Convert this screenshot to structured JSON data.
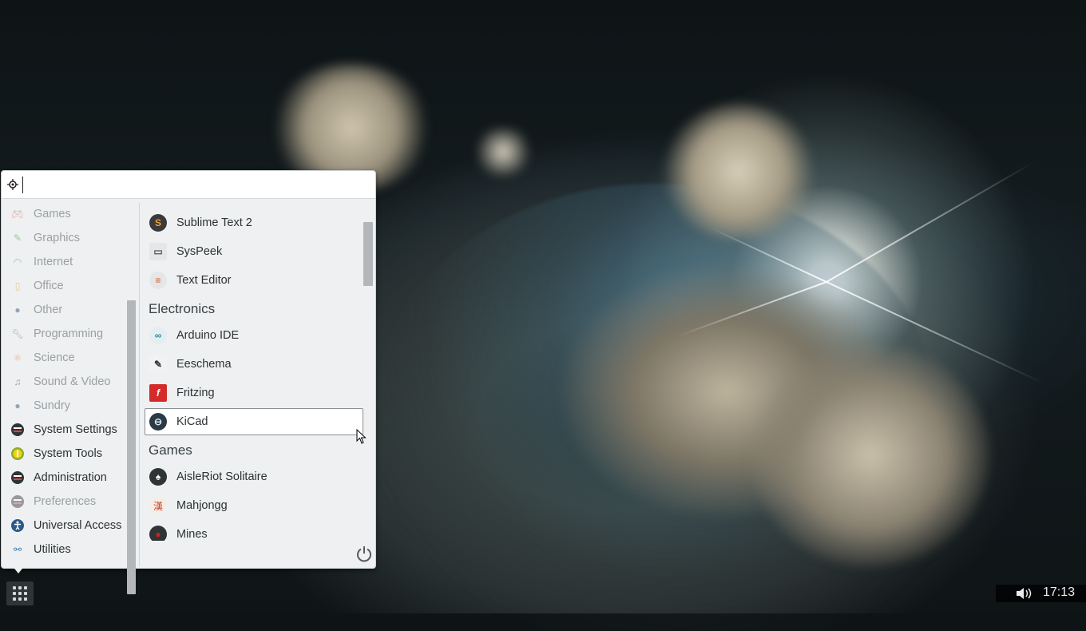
{
  "search": {
    "value": "",
    "placeholder": ""
  },
  "categories": [
    {
      "label": "Games",
      "icon": "gamepad-icon",
      "active": false
    },
    {
      "label": "Graphics",
      "icon": "brush-icon",
      "active": false
    },
    {
      "label": "Internet",
      "icon": "globe-icon",
      "active": false
    },
    {
      "label": "Office",
      "icon": "document-icon",
      "active": false
    },
    {
      "label": "Other",
      "icon": "other-icon",
      "active": false
    },
    {
      "label": "Programming",
      "icon": "wrench-icon",
      "active": false
    },
    {
      "label": "Science",
      "icon": "atom-icon",
      "active": false
    },
    {
      "label": "Sound & Video",
      "icon": "music-icon",
      "active": false
    },
    {
      "label": "Sundry",
      "icon": "sundry-icon",
      "active": false
    },
    {
      "label": "System Settings",
      "icon": "settings-icon",
      "active": true
    },
    {
      "label": "System Tools",
      "icon": "info-icon",
      "active": true
    },
    {
      "label": "Administration",
      "icon": "admin-icon",
      "active": true
    },
    {
      "label": "Preferences",
      "icon": "preferences-icon",
      "active": false
    },
    {
      "label": "Universal Access",
      "icon": "accessibility-icon",
      "active": true
    },
    {
      "label": "Utilities",
      "icon": "utilities-icon",
      "active": true
    }
  ],
  "apps": {
    "top_items": [
      {
        "label": "Sublime Text 2",
        "icon": "sublime-icon",
        "glyph": "S",
        "color": "#e8821f"
      },
      {
        "label": "SysPeek",
        "icon": "syspeek-icon",
        "glyph": "▭",
        "color": "#9aa0a3"
      },
      {
        "label": "Text Editor",
        "icon": "text-editor-icon",
        "glyph": "≡",
        "color": "#c9ccce"
      }
    ],
    "electronics_header": "Electronics",
    "electronics": [
      {
        "label": "Arduino IDE",
        "icon": "arduino-icon",
        "glyph": "∞",
        "color": "#3c9cb0"
      },
      {
        "label": "Eeschema",
        "icon": "eeschema-icon",
        "glyph": "✎",
        "color": "#6b7174"
      },
      {
        "label": "Fritzing",
        "icon": "fritzing-icon",
        "glyph": "f",
        "color": "#d12a2a"
      },
      {
        "label": "KiCad",
        "icon": "kicad-icon",
        "glyph": "⊖",
        "color": "#2b3a44"
      }
    ],
    "games_header": "Games",
    "games": [
      {
        "label": "AisleRiot Solitaire",
        "icon": "solitaire-icon",
        "glyph": "♠",
        "color": "#2f3436"
      },
      {
        "label": "Mahjongg",
        "icon": "mahjongg-icon",
        "glyph": "漢",
        "color": "#d04030"
      },
      {
        "label": "Mines",
        "icon": "mines-icon",
        "glyph": "●",
        "color": "#c02020"
      }
    ]
  },
  "panel": {
    "clock": "17:13"
  }
}
